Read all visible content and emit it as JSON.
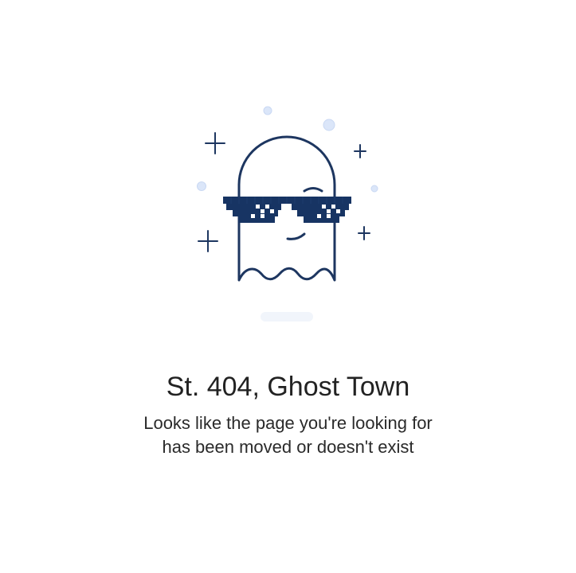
{
  "error_page": {
    "title": "St. 404, Ghost Town",
    "message_line1": "Looks like the page you're looking for",
    "message_line2": "has been moved or doesn't exist"
  },
  "illustration": {
    "icon": "ghost-with-pixel-sunglasses",
    "colors": {
      "ghost_stroke": "#1d3660",
      "sunglasses": "#173463",
      "lens_highlight": "#ffffff",
      "bubbles": "#d7e3f8",
      "shadow": "#f1f5fb"
    }
  }
}
